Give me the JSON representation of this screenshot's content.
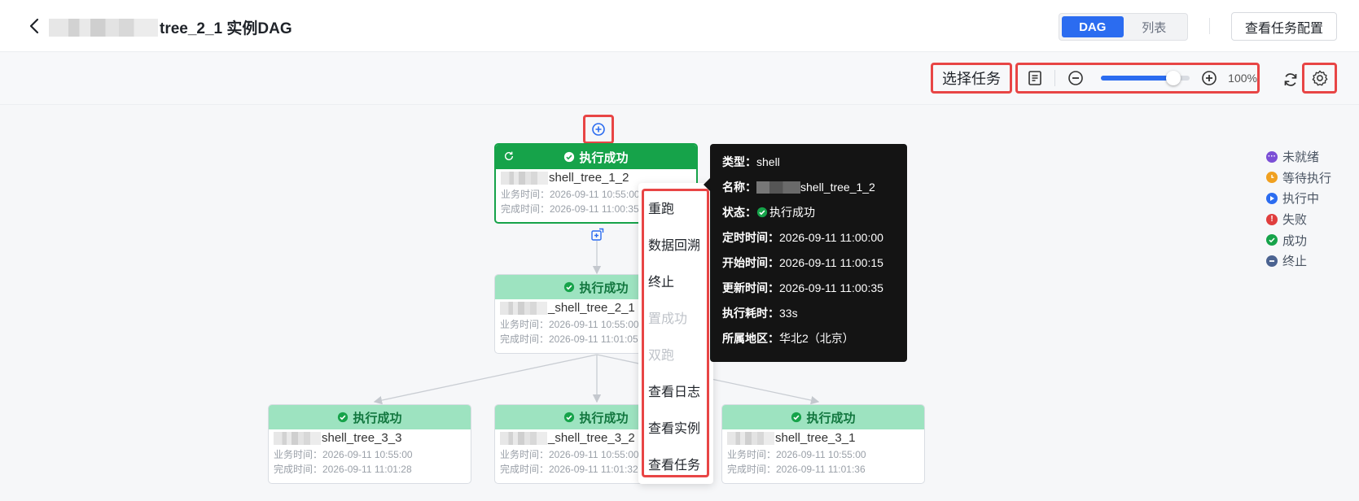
{
  "header": {
    "title_suffix": "tree_2_1 实例DAG",
    "view_tabs": [
      "DAG",
      "列表"
    ],
    "config_button": "查看任务配置"
  },
  "toolbar": {
    "select_task": "选择任务",
    "zoom_level": "100%",
    "zoom_fraction": 0.8
  },
  "nodes": [
    {
      "status": "执行成功",
      "name": "shell_tree_1_2",
      "biz_time": "业务时间：2026-09-11 10:55:00",
      "done_time": "完成时间：2026-09-11 11:00:35"
    },
    {
      "status": "执行成功",
      "name": "_shell_tree_2_1",
      "biz_time": "业务时间：2026-09-11 10:55:00",
      "done_time": "完成时间：2026-09-11 11:01:05"
    },
    {
      "status": "执行成功",
      "name": "shell_tree_3_3",
      "biz_time": "业务时间：2026-09-11 10:55:00",
      "done_time": "完成时间：2026-09-11 11:01:28"
    },
    {
      "status": "执行成功",
      "name": "_shell_tree_3_2",
      "biz_time": "业务时间：2026-09-11 10:55:00",
      "done_time": "完成时间：2026-09-11 11:01:32"
    },
    {
      "status": "执行成功",
      "name": "shell_tree_3_1",
      "biz_time": "业务时间：2026-09-11 10:55:00",
      "done_time": "完成时间：2026-09-11 11:01:36"
    }
  ],
  "context_menu": {
    "items": [
      {
        "label": "重跑",
        "disabled": false
      },
      {
        "label": "数据回溯",
        "disabled": false
      },
      {
        "label": "终止",
        "disabled": false
      },
      {
        "label": "置成功",
        "disabled": true
      },
      {
        "label": "双跑",
        "disabled": true
      },
      {
        "label": "查看日志",
        "disabled": false
      },
      {
        "label": "查看实例",
        "disabled": false
      },
      {
        "label": "查看任务",
        "disabled": false
      }
    ]
  },
  "tooltip": {
    "type_label": "类型：",
    "type_value": "shell",
    "name_label": "名称：",
    "name_value": "shell_tree_1_2",
    "status_label": "状态：",
    "status_value": "执行成功",
    "scheduled_label": "定时时间：",
    "scheduled_value": "2026-09-11 11:00:00",
    "start_label": "开始时间：",
    "start_value": "2026-09-11 11:00:15",
    "update_label": "更新时间：",
    "update_value": "2026-09-11 11:00:35",
    "duration_label": "执行耗时：",
    "duration_value": "33s",
    "region_label": "所属地区：",
    "region_value": "华北2（北京）"
  },
  "legend": [
    {
      "label": "未就绪",
      "color": "#7b4fd6",
      "icon": "ellipsis-icon"
    },
    {
      "label": "等待执行",
      "color": "#f0a020",
      "icon": "clock-icon"
    },
    {
      "label": "执行中",
      "color": "#2b6cf0",
      "icon": "play-icon"
    },
    {
      "label": "失败",
      "color": "#e03e3e",
      "icon": "exclamation-icon"
    },
    {
      "label": "成功",
      "color": "#16a34a",
      "icon": "check-icon"
    },
    {
      "label": "终止",
      "color": "#4b6391",
      "icon": "minus-icon"
    }
  ],
  "colors": {
    "accent": "#2b6cf0",
    "success": "#16a34a",
    "highlight_box": "#e84545"
  }
}
